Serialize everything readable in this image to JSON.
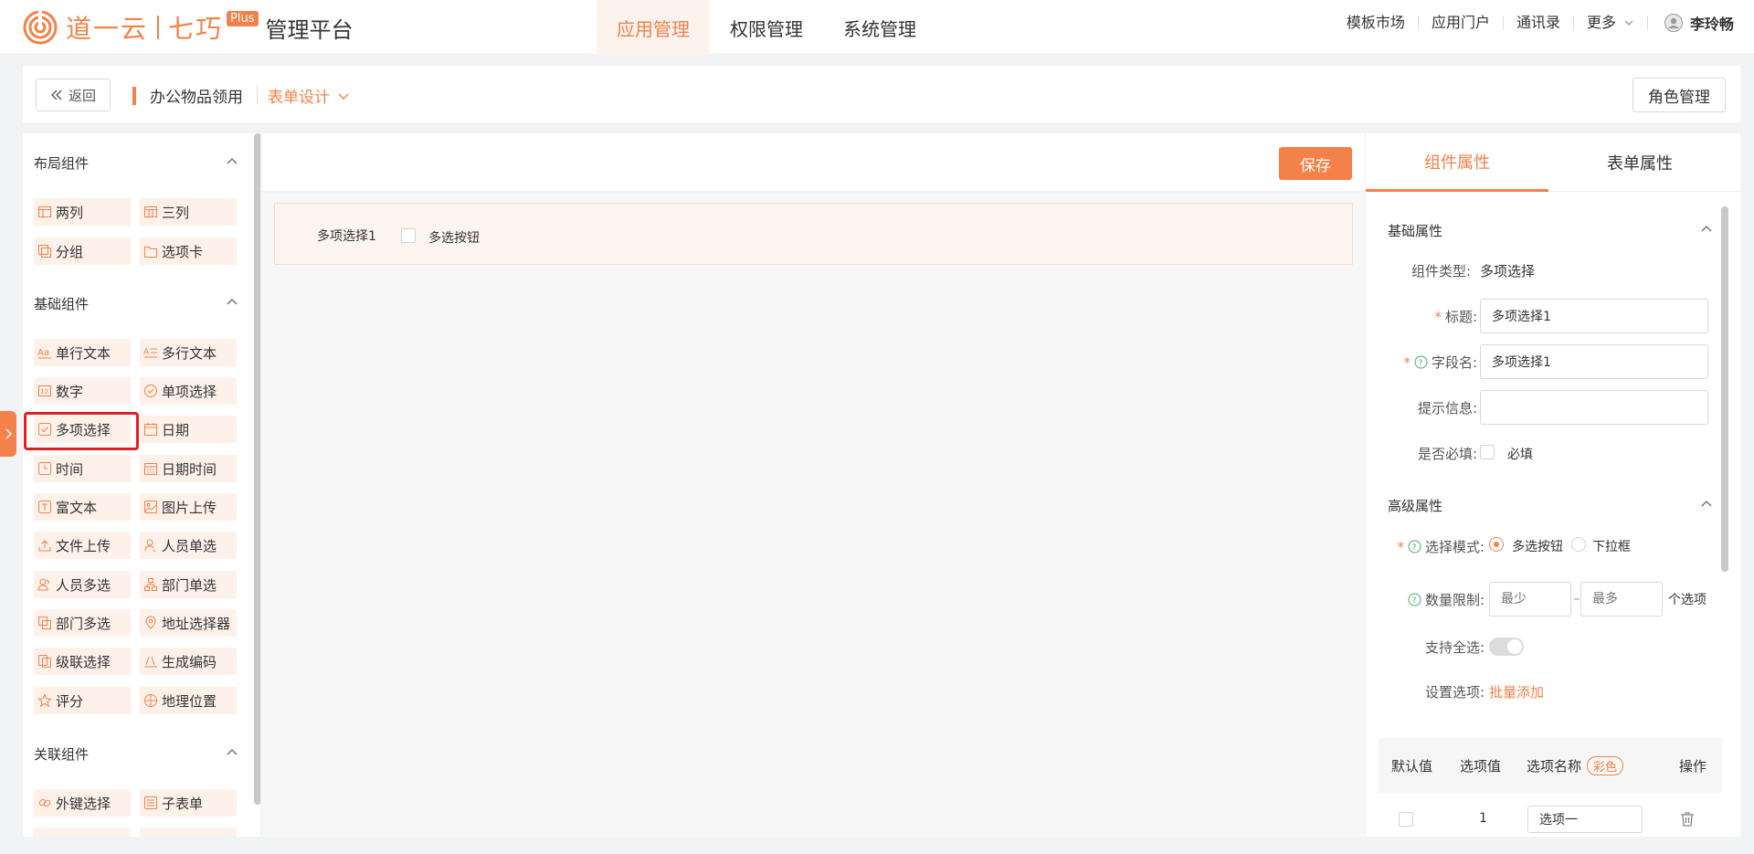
{
  "header": {
    "brand": "道一云",
    "product": "七巧",
    "plus_badge": "Plus",
    "platform": "管理平台",
    "nav": [
      {
        "label": "应用管理",
        "active": true
      },
      {
        "label": "权限管理",
        "active": false
      },
      {
        "label": "系统管理",
        "active": false
      }
    ],
    "right_links": [
      "模板市场",
      "应用门户",
      "通讯录",
      "更多"
    ],
    "user_name": "李玲畅"
  },
  "subbar": {
    "back_label": "返回",
    "app_name": "办公物品领用",
    "mode": "表单设计",
    "role_button": "角色管理"
  },
  "left_panel": {
    "sections": [
      {
        "title": "布局组件",
        "items": [
          "两列",
          "三列",
          "分组",
          "选项卡"
        ]
      },
      {
        "title": "基础组件",
        "items": [
          "单行文本",
          "多行文本",
          "数字",
          "单项选择",
          "多项选择",
          "日期",
          "时间",
          "日期时间",
          "富文本",
          "图片上传",
          "文件上传",
          "人员单选",
          "人员多选",
          "部门单选",
          "部门多选",
          "地址选择器",
          "级联选择",
          "生成编码",
          "评分",
          "地理位置"
        ]
      },
      {
        "title": "关联组件",
        "items": [
          "外键选择",
          "子表单"
        ]
      }
    ],
    "highlighted_item": "多项选择"
  },
  "canvas": {
    "save_label": "保存",
    "field": {
      "label": "多项选择1",
      "option": "多选按钮"
    }
  },
  "right_panel": {
    "tabs": [
      {
        "label": "组件属性",
        "active": true
      },
      {
        "label": "表单属性",
        "active": false
      }
    ],
    "basic": {
      "title": "基础属性",
      "type_label": "组件类型:",
      "type_value": "多项选择",
      "title_label": "标题:",
      "title_value": "多项选择1",
      "field_label": "字段名:",
      "field_value": "多项选择1",
      "hint_label": "提示信息:",
      "hint_value": "",
      "required_label": "是否必填:",
      "required_option": "必填"
    },
    "advanced": {
      "title": "高级属性",
      "mode_label": "选择模式:",
      "mode_options": [
        "多选按钮",
        "下拉框"
      ],
      "mode_selected": "多选按钮",
      "limit_label": "数量限制:",
      "min_placeholder": "最少",
      "max_placeholder": "最多",
      "limit_dash": "–",
      "limit_unit": "个选项",
      "select_all_label": "支持全选:",
      "options_label": "设置选项:",
      "batch_add": "批量添加"
    },
    "table": {
      "headers": [
        "默认值",
        "选项值",
        "选项名称",
        "操作"
      ],
      "color_tag": "彩色",
      "rows": [
        {
          "value": "1",
          "name": "选项一"
        }
      ]
    }
  },
  "colors": {
    "accent": "#f5814a",
    "highlight": "#e02020"
  }
}
